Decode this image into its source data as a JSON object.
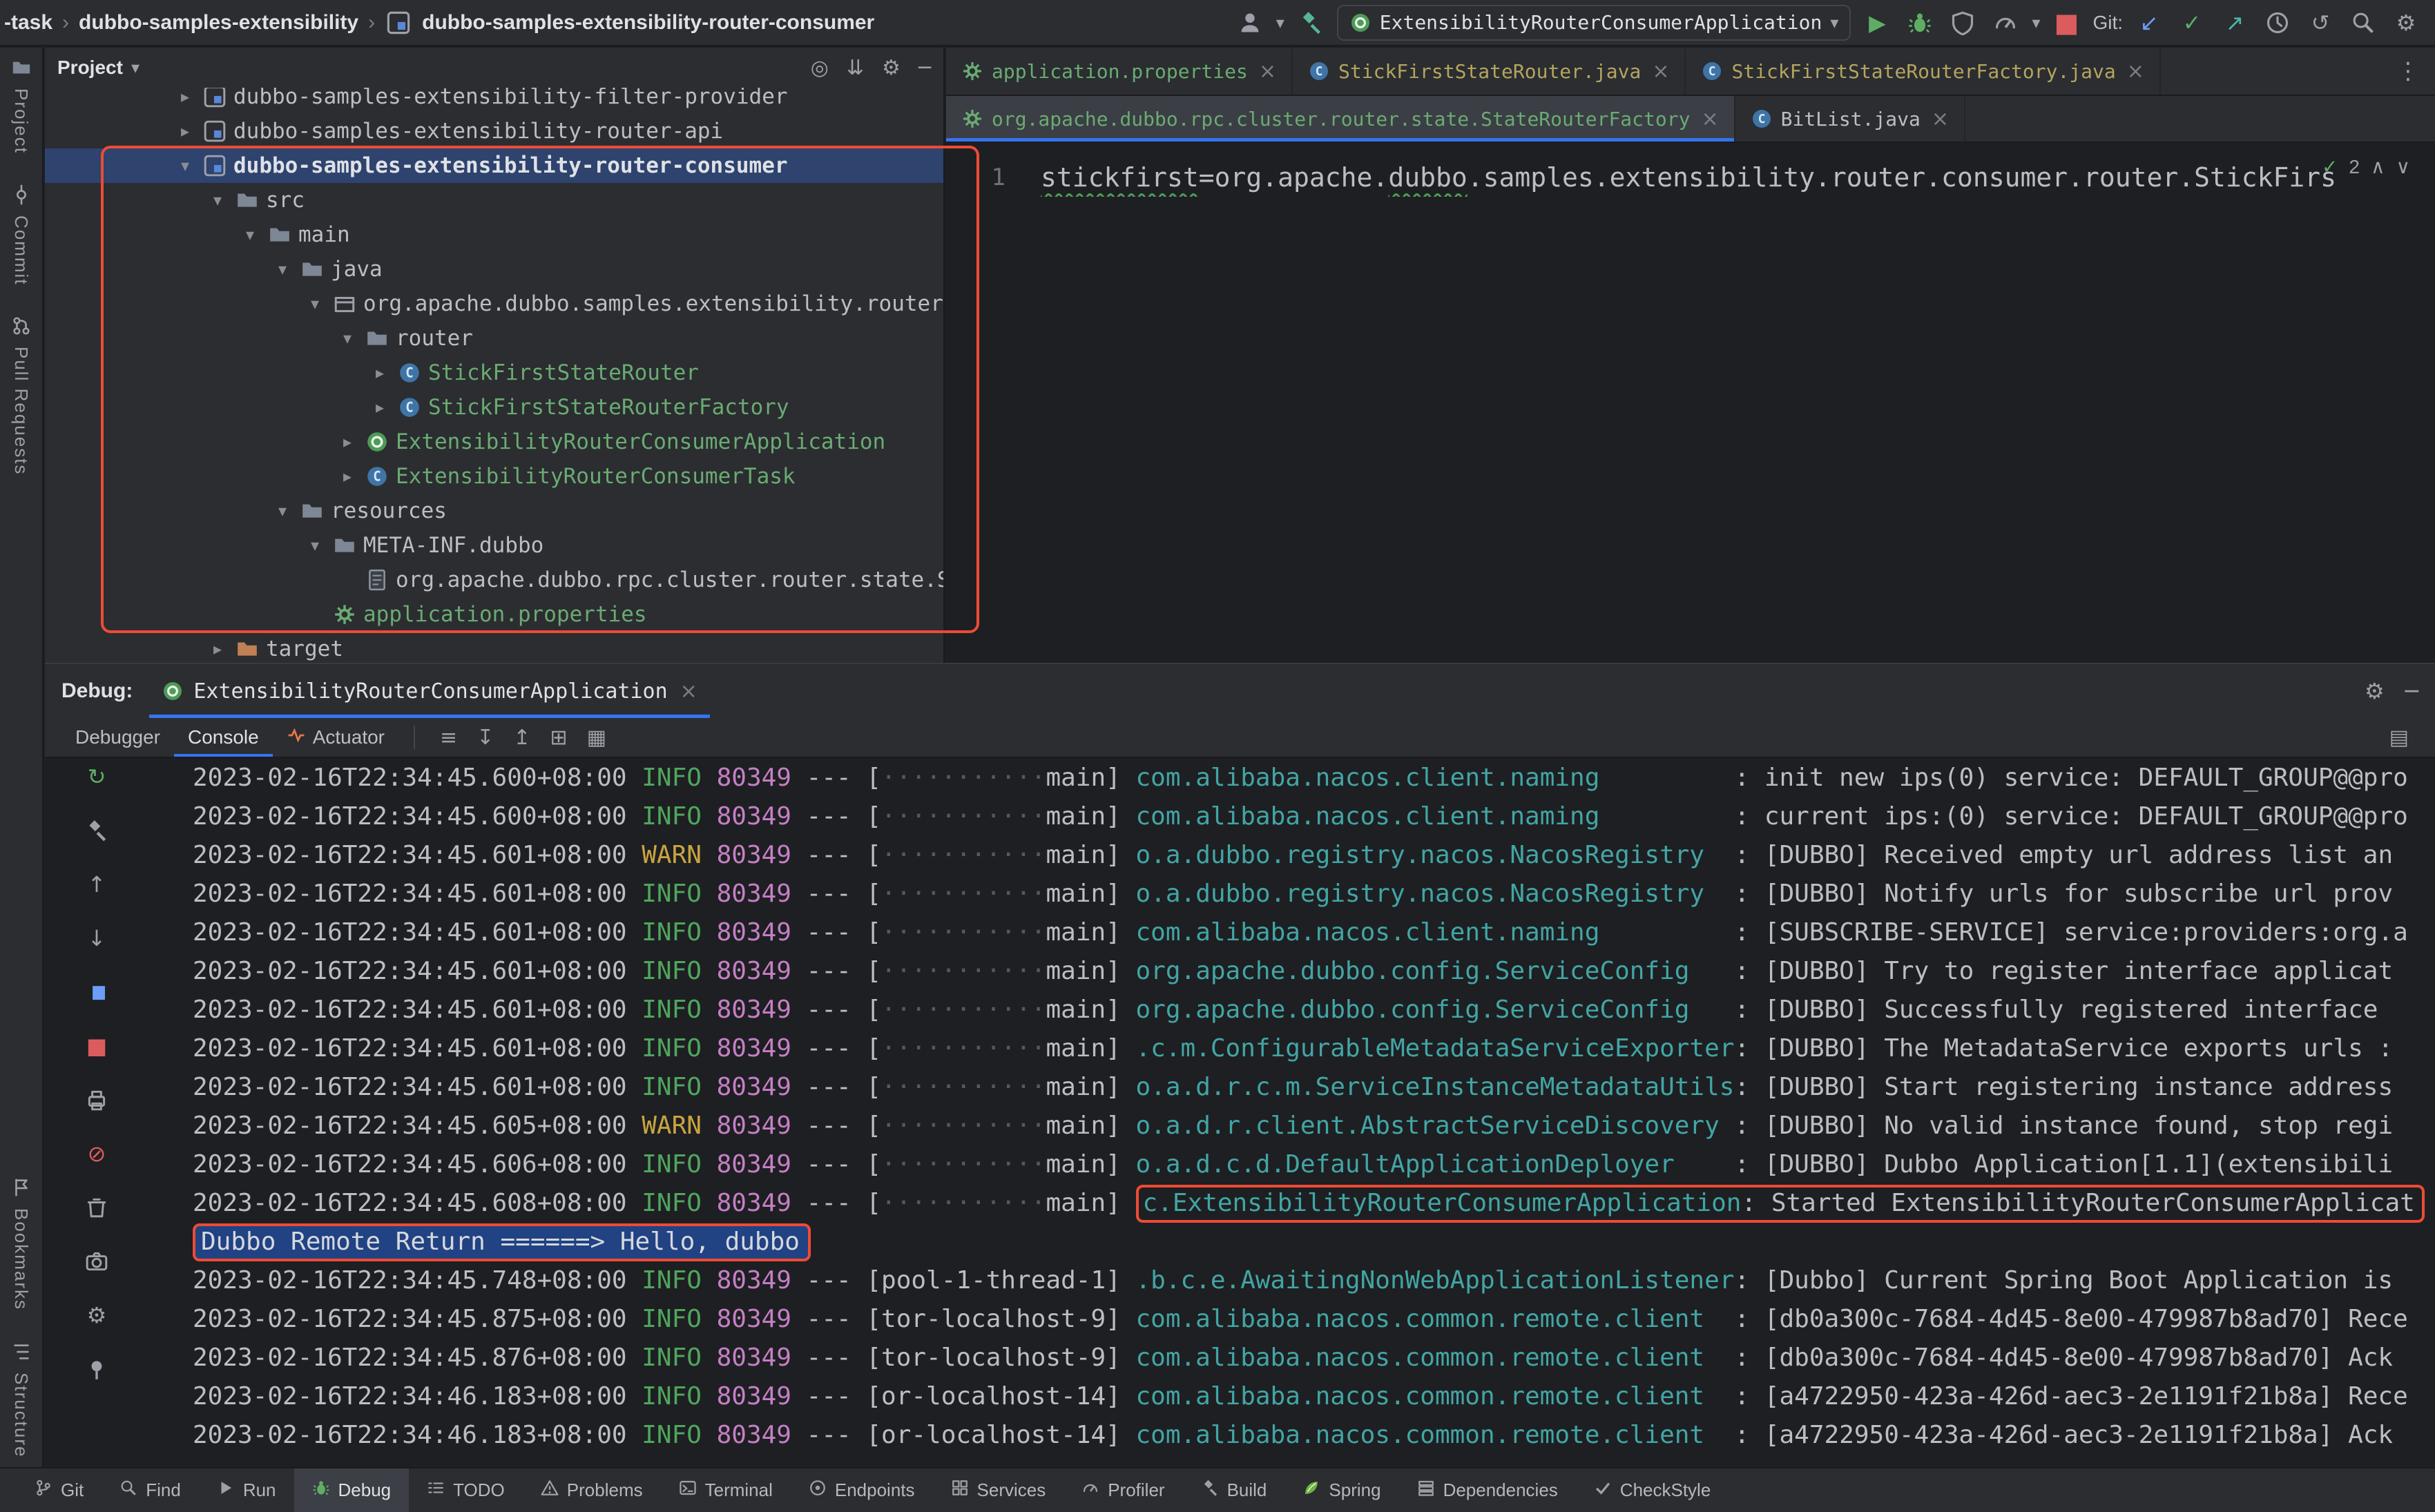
{
  "icons": {
    "chevron_down": "▾",
    "chevron_right": "▸",
    "caret": "▾",
    "play": "▶",
    "stop": "■",
    "check": "✓",
    "close": "×",
    "kebab": "⋮",
    "minus": "─",
    "menu": "≡",
    "arrow_up": "↑",
    "arrow_down": "↓",
    "arrow_up_right": "↗",
    "arrow_down_left": "↙",
    "rerun": "↻",
    "undo": "↺",
    "pause": "▮▮",
    "no_entry": "⊘",
    "gear": "⚙",
    "scroll_down": "↧",
    "scroll_up": "↥",
    "collapse_all": "⇊",
    "locate": "◎",
    "grid": "▦",
    "layout": "▤",
    "split": "⊞",
    "up_chevron": "∧",
    "down_chevron": "∨",
    "separator": "›"
  },
  "titlebar": {
    "window_title": "-task",
    "separator": "›",
    "breadcrumb1": "dubbo-samples-extensibility",
    "breadcrumb2": "dubbo-samples-extensibility-router-consumer",
    "run_config": "ExtensibilityRouterConsumerApplication",
    "git_label": "Git:"
  },
  "left_stripe": {
    "top": [
      {
        "label": "Project",
        "icon": "folder"
      },
      {
        "label": "Commit",
        "icon": "commit"
      },
      {
        "label": "Pull Requests",
        "icon": "pullrequest"
      }
    ],
    "bottom": [
      {
        "label": "Bookmarks",
        "icon": "flag"
      },
      {
        "label": "Structure",
        "icon": "structure"
      }
    ]
  },
  "project_panel": {
    "title": "Project",
    "tree": [
      {
        "label": "dubbo-samples-extensibility-filter-provider",
        "level": 0,
        "icon": "module",
        "chevron": "right"
      },
      {
        "label": "dubbo-samples-extensibility-router-api",
        "level": 0,
        "icon": "module",
        "chevron": "right"
      },
      {
        "label": "dubbo-samples-extensibility-router-consumer",
        "level": 0,
        "icon": "module",
        "chevron": "down",
        "selected": true
      },
      {
        "label": "src",
        "level": 1,
        "icon": "folder",
        "chevron": "down"
      },
      {
        "label": "main",
        "level": 2,
        "icon": "folder",
        "chevron": "down"
      },
      {
        "label": "java",
        "level": 3,
        "icon": "folder",
        "chevron": "down"
      },
      {
        "label": "org.apache.dubbo.samples.extensibility.router.c",
        "level": 4,
        "icon": "package",
        "chevron": "down"
      },
      {
        "label": "router",
        "level": 5,
        "icon": "folder",
        "chevron": "down"
      },
      {
        "label": "StickFirstStateRouter",
        "level": 6,
        "icon": "class",
        "chevron": "right",
        "color": "#6aab73"
      },
      {
        "label": "StickFirstStateRouterFactory",
        "level": 6,
        "icon": "class",
        "chevron": "right",
        "color": "#6aab73"
      },
      {
        "label": "ExtensibilityRouterConsumerApplication",
        "level": 5,
        "icon": "springboot",
        "chevron": "right",
        "color": "#6aab73"
      },
      {
        "label": "ExtensibilityRouterConsumerTask",
        "level": 5,
        "icon": "class",
        "chevron": "right",
        "color": "#6aab73"
      },
      {
        "label": "resources",
        "level": 3,
        "icon": "folder",
        "chevron": "down"
      },
      {
        "label": "META-INF.dubbo",
        "level": 4,
        "icon": "folder",
        "chevron": "down"
      },
      {
        "label": "org.apache.dubbo.rpc.cluster.router.state.St",
        "level": 5,
        "icon": "file-text",
        "chevron": "none"
      },
      {
        "label": "application.properties",
        "level": 4,
        "icon": "spring-config",
        "chevron": "none",
        "color": "#6aab73"
      },
      {
        "label": "target",
        "level": 1,
        "icon": "folder-excluded",
        "chevron": "right"
      }
    ]
  },
  "editor": {
    "tabs_row1": [
      {
        "label": "application.properties",
        "icon": "spring-config",
        "color": "#6aab73"
      },
      {
        "label": "StickFirstStateRouter.java",
        "icon": "class",
        "color": "#b3a55f"
      },
      {
        "label": "StickFirstStateRouterFactory.java",
        "icon": "class",
        "color": "#b3a55f"
      }
    ],
    "tabs_row2": [
      {
        "label": "org.apache.dubbo.rpc.cluster.router.state.StateRouterFactory",
        "icon": "spring-config",
        "color": "#6aab73",
        "active": true
      },
      {
        "label": "BitList.java",
        "icon": "class",
        "color": "#bcbec4"
      }
    ],
    "line_number": "1",
    "code_segments": [
      {
        "text": "stickfirst",
        "squiggle": true
      },
      {
        "text": "=org.apache."
      },
      {
        "text": "dubbo",
        "squiggle": true
      },
      {
        "text": ".samples.extensibility.router.consumer.router.StickFirs"
      }
    ],
    "inspections_count": "2"
  },
  "debug_panel": {
    "label": "Debug:",
    "session_tab": "ExtensibilityRouterConsumerApplication",
    "tabs": [
      {
        "label": "Debugger"
      },
      {
        "label": "Console",
        "active": true
      },
      {
        "label": "Actuator",
        "icon": "actuator"
      }
    ],
    "toolbar_icons": [
      {
        "name": "options-menu-icon",
        "glyph": "≡"
      },
      {
        "name": "scroll-to-end-icon",
        "glyph": "↧"
      },
      {
        "name": "scroll-to-top-icon",
        "glyph": "↥"
      },
      {
        "name": "split-window-icon",
        "glyph": "⊞"
      },
      {
        "name": "grid-icon",
        "glyph": "▦"
      }
    ],
    "layout_icon_glyph": "▤",
    "left_toolbar": [
      {
        "name": "rerun-icon",
        "glyph": "↻",
        "color": "#5fad65"
      },
      {
        "name": "build-hammer-icon",
        "svg": "hammer"
      },
      {
        "name": "step-up-icon",
        "glyph": "↑"
      },
      {
        "name": "step-down-icon",
        "glyph": "↓"
      },
      {
        "name": "pause-icon",
        "glyph": "▮▮",
        "color": "#6c9ef8"
      },
      {
        "name": "stop-icon",
        "glyph": "■",
        "color": "#db5c5c"
      },
      {
        "name": "print-icon",
        "svg": "printer"
      },
      {
        "name": "mute-breakpoints-icon",
        "glyph": "⊘",
        "color": "#db5c5c"
      },
      {
        "name": "clear-icon",
        "svg": "trash"
      },
      {
        "name": "camera-icon",
        "svg": "camera"
      },
      {
        "name": "settings-gear-icon",
        "glyph": "⚙"
      },
      {
        "name": "pin-icon",
        "svg": "pin"
      }
    ],
    "console": {
      "lines": [
        {
          "time": "2023-02-16T22:34:45.600+08:00",
          "level": "INFO",
          "pid": "80349",
          "thread": "main",
          "logger": "com.alibaba.nacos.client.naming",
          "msg": "init new ips(0) service: DEFAULT_GROUP@@pro"
        },
        {
          "time": "2023-02-16T22:34:45.600+08:00",
          "level": "INFO",
          "pid": "80349",
          "thread": "main",
          "logger": "com.alibaba.nacos.client.naming",
          "msg": "current ips:(0) service: DEFAULT_GROUP@@pro"
        },
        {
          "time": "2023-02-16T22:34:45.601+08:00",
          "level": "WARN",
          "pid": "80349",
          "thread": "main",
          "logger": "o.a.dubbo.registry.nacos.NacosRegistry",
          "msg": "[DUBBO] Received empty url address list an"
        },
        {
          "time": "2023-02-16T22:34:45.601+08:00",
          "level": "INFO",
          "pid": "80349",
          "thread": "main",
          "logger": "o.a.dubbo.registry.nacos.NacosRegistry",
          "msg": "[DUBBO] Notify urls for subscribe url prov"
        },
        {
          "time": "2023-02-16T22:34:45.601+08:00",
          "level": "INFO",
          "pid": "80349",
          "thread": "main",
          "logger": "com.alibaba.nacos.client.naming",
          "msg": "[SUBSCRIBE-SERVICE] service:providers:org.a"
        },
        {
          "time": "2023-02-16T22:34:45.601+08:00",
          "level": "INFO",
          "pid": "80349",
          "thread": "main",
          "logger": "org.apache.dubbo.config.ServiceConfig",
          "msg": "[DUBBO] Try to register interface applicat"
        },
        {
          "time": "2023-02-16T22:34:45.601+08:00",
          "level": "INFO",
          "pid": "80349",
          "thread": "main",
          "logger": "org.apache.dubbo.config.ServiceConfig",
          "msg": "[DUBBO] Successfully registered interface"
        },
        {
          "time": "2023-02-16T22:34:45.601+08:00",
          "level": "INFO",
          "pid": "80349",
          "thread": "main",
          "logger": ".c.m.ConfigurableMetadataServiceExporter",
          "msg": "[DUBBO] The MetadataService exports urls :"
        },
        {
          "time": "2023-02-16T22:34:45.601+08:00",
          "level": "INFO",
          "pid": "80349",
          "thread": "main",
          "logger": "o.a.d.r.c.m.ServiceInstanceMetadataUtils",
          "msg": "[DUBBO] Start registering instance address"
        },
        {
          "time": "2023-02-16T22:34:45.605+08:00",
          "level": "WARN",
          "pid": "80349",
          "thread": "main",
          "logger": "o.a.d.r.client.AbstractServiceD iscovery",
          "msg": "[DUBBO] No valid instance found, stop regi",
          "logger_fix": "o.a.d.r.client.AbstractServiceDiscovery"
        },
        {
          "time": "2023-02-16T22:34:45.606+08:00",
          "level": "INFO",
          "pid": "80349",
          "thread": "main",
          "logger": "o.a.d.c.d.DefaultApplicationDeployer",
          "msg": "[DUBBO] Dubbo Application[1.1](extensibili"
        },
        {
          "time": "2023-02-16T22:34:45.608+08:00",
          "level": "INFO",
          "pid": "80349",
          "thread": "main",
          "logger": "c.ExtensibilityRouterConsumerApplication",
          "msg": "Started ExtensibilityRouterConsumerApplicat",
          "annotated": true
        },
        {
          "stdout": "Dubbo Remote Return ======> Hello, dubbo",
          "selected": true,
          "annotated": true
        },
        {
          "time": "2023-02-16T22:34:45.748+08:00",
          "level": "INFO",
          "pid": "80349",
          "thread": "pool-1-thread-1",
          "logger": ".b.c.e.AwaitingNonWebApplicationListener",
          "msg": "[Dubbo] Current Spring Boot Application is"
        },
        {
          "time": "2023-02-16T22:34:45.875+08:00",
          "level": "INFO",
          "pid": "80349",
          "thread": "tor-localhost-9",
          "logger": "com.alibaba.nacos.common.remote.client",
          "msg": "[db0a300c-7684-4d45-8e00-479987b8ad70] Rece"
        },
        {
          "time": "2023-02-16T22:34:45.876+08:00",
          "level": "INFO",
          "pid": "80349",
          "thread": "tor-localhost-9",
          "logger": "com.alibaba.nacos.common.remote.client",
          "msg": "[db0a300c-7684-4d45-8e00-479987b8ad70] Ack"
        },
        {
          "time": "2023-02-16T22:34:46.183+08:00",
          "level": "INFO",
          "pid": "80349",
          "thread": "or-localhost-14",
          "logger": "com.alibaba.nacos.common.remote.client",
          "msg": "[a4722950-423a-426d-aec3-2e1191f21b8a] Rece"
        },
        {
          "time": "2023-02-16T22:34:46.183+08:00",
          "level": "INFO",
          "pid": "80349",
          "thread": "or-localhost-14",
          "logger": "com.alibaba.nacos.common.remote.client",
          "msg": "[a4722950-423a-426d-aec3-2e1191f21b8a] Ack"
        }
      ]
    }
  },
  "statusbar": {
    "items": [
      {
        "label": "Git",
        "icon": "branch"
      },
      {
        "label": "Find",
        "icon": "search"
      },
      {
        "label": "Run",
        "icon": "playicon"
      },
      {
        "label": "Debug",
        "icon": "bug",
        "active": true
      },
      {
        "label": "TODO",
        "icon": "todo"
      },
      {
        "label": "Problems",
        "icon": "problems"
      },
      {
        "label": "Terminal",
        "icon": "terminal"
      },
      {
        "label": "Endpoints",
        "icon": "endpoints"
      },
      {
        "label": "Services",
        "icon": "services"
      },
      {
        "label": "Profiler",
        "icon": "profiler"
      },
      {
        "label": "Build",
        "icon": "hammer"
      },
      {
        "label": "Spring",
        "icon": "spring"
      },
      {
        "label": "Dependencies",
        "icon": "dependencies"
      },
      {
        "label": "CheckStyle",
        "icon": "checkstyle"
      }
    ]
  }
}
